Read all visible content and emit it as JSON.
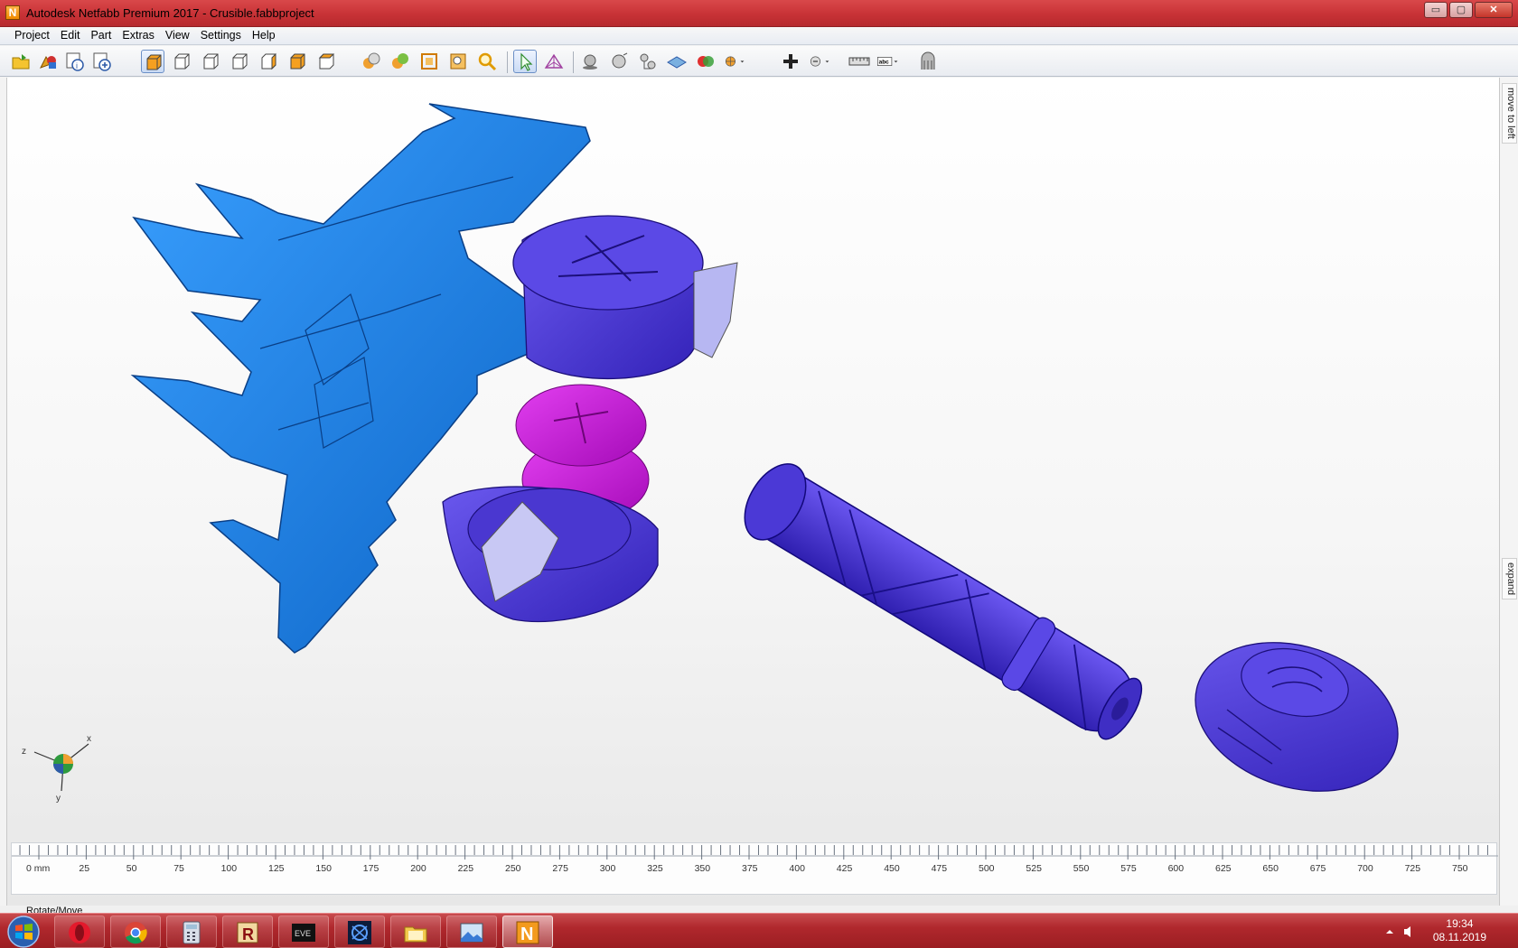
{
  "window": {
    "title": "Autodesk Netfabb Premium 2017 - Crusible.fabbproject",
    "app_icon_letter": "N",
    "buttons": {
      "minimize": "▭",
      "maximize": "▢",
      "close": "✕"
    }
  },
  "menu": [
    "Project",
    "Edit",
    "Part",
    "Extras",
    "View",
    "Settings",
    "Help"
  ],
  "toolbar": {
    "groups": [
      [
        "open-project",
        "add-part",
        "part-info",
        "new-part"
      ],
      [
        "view-default",
        "view-front",
        "view-back",
        "view-left",
        "view-right",
        "view-top",
        "view-bottom"
      ],
      [
        "shade-solid",
        "shade-colored",
        "shade-wireframe",
        "zoom-to-fit",
        "zoom-magnifier"
      ],
      [
        "select-pointer",
        "select-triangles"
      ],
      [
        "add-sphere",
        "add-half-sphere",
        "add-cylinder",
        "add-surface",
        "add-color",
        "add-slice-dropdown"
      ],
      [
        "add-cross",
        "measure-dropdown",
        "ruler-tool",
        "label-abc-dropdown",
        "support-tool"
      ]
    ],
    "label_tool_text": "abc"
  },
  "viewport": {
    "axis_labels": {
      "x": "x",
      "y": "y",
      "z": "z"
    },
    "colors": {
      "blade": "#1a7fe6",
      "head_purple": "#4b35d6",
      "disc_magenta": "#c514d6",
      "spike_lavender": "#a8a8ee",
      "handle": "#4a36d8"
    }
  },
  "sidepanel": {
    "top_tab": "move to left",
    "bottom_tab": "expand"
  },
  "ruler": {
    "unit": "mm",
    "labels": [
      "0 mm",
      "25",
      "50",
      "75",
      "100",
      "125",
      "150",
      "175",
      "200",
      "225",
      "250",
      "275",
      "300",
      "325",
      "350",
      "375",
      "400",
      "425",
      "450",
      "475",
      "500",
      "525",
      "550",
      "575",
      "600",
      "625",
      "650",
      "675",
      "700",
      "725",
      "750"
    ]
  },
  "status": {
    "mode": "Rotate/Move"
  },
  "taskbar": {
    "apps": [
      "opera",
      "chrome",
      "calculator",
      "revit",
      "eve-online",
      "maxon-cinema",
      "file-explorer",
      "image-viewer",
      "netfabb"
    ],
    "netfabb_label": "N",
    "eve_label": "EVE",
    "time": "19:34",
    "date": "08.11.2019"
  }
}
